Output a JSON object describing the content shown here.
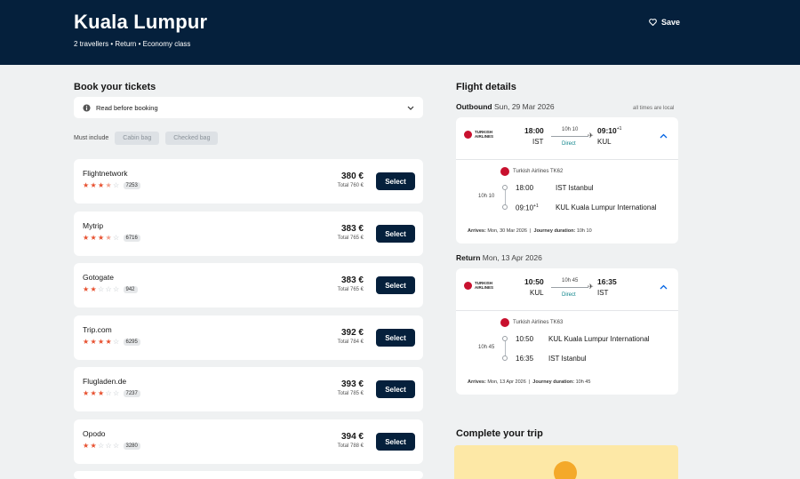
{
  "header": {
    "title": "Kuala Lumpur",
    "subtitle": "2 travellers • Return • Economy class",
    "save_label": "Save"
  },
  "booking": {
    "heading": "Book your tickets",
    "read_label": "Read before booking",
    "must_include_label": "Must include",
    "chips": [
      "Cabin bag",
      "Checked bag"
    ],
    "providers": [
      {
        "name": "Flightnetwork",
        "stars": 3.5,
        "reviews": "7253",
        "price": "380 €",
        "total": "Total 760 €",
        "button": "Select"
      },
      {
        "name": "Mytrip",
        "stars": 3.5,
        "reviews": "6716",
        "price": "383 €",
        "total": "Total 765 €",
        "button": "Select"
      },
      {
        "name": "Gotogate",
        "stars": 2,
        "reviews": "942",
        "price": "383 €",
        "total": "Total 765 €",
        "button": "Select"
      },
      {
        "name": "Trip.com",
        "stars": 4,
        "reviews": "6295",
        "price": "392 €",
        "total": "Total 784 €",
        "button": "Select"
      },
      {
        "name": "Flugladen.de",
        "stars": 3,
        "reviews": "7237",
        "price": "393 €",
        "total": "Total 785 €",
        "button": "Select"
      },
      {
        "name": "Opodo",
        "stars": 2,
        "reviews": "3280",
        "price": "394 €",
        "total": "Total 788 €",
        "button": "Select"
      }
    ]
  },
  "flight": {
    "heading": "Flight details",
    "times_note": "all times are local",
    "airline_logo_text": "TURKISH AIRLINES",
    "outbound": {
      "label": "Outbound",
      "date": "Sun, 29 Mar 2026",
      "dep_time": "18:00",
      "dep_code": "IST",
      "arr_time": "09:10",
      "arr_offset": "+1",
      "arr_code": "KUL",
      "duration": "10h 10",
      "stops": "Direct",
      "flight_no": "Turkish Airlines TK62",
      "leg_duration": "10h 10",
      "dep_airport": "IST Istanbul",
      "arr_airport": "KUL Kuala Lumpur International",
      "arrives_label": "Arrives:",
      "arrives_value": "Mon, 30 Mar 2026",
      "journey_label": "Journey duration:",
      "journey_value": "10h 10"
    },
    "return": {
      "label": "Return",
      "date": "Mon, 13 Apr 2026",
      "dep_time": "10:50",
      "dep_code": "KUL",
      "arr_time": "16:35",
      "arr_code": "IST",
      "duration": "10h 45",
      "stops": "Direct",
      "flight_no": "Turkish Airlines TK63",
      "leg_duration": "10h 45",
      "dep_airport": "KUL Kuala Lumpur International",
      "arr_airport": "IST Istanbul",
      "arrives_label": "Arrives:",
      "arrives_value": "Mon, 13 Apr 2026",
      "journey_label": "Journey duration:",
      "journey_value": "10h 45"
    }
  },
  "complete": {
    "heading": "Complete your trip"
  }
}
